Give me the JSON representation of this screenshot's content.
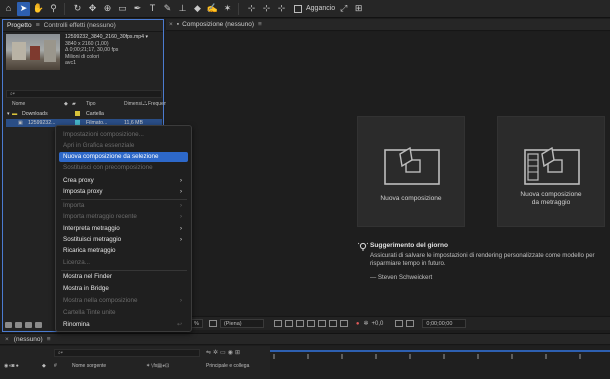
{
  "toolbar": {
    "tools": [
      "home-icon",
      "selection-arrow-icon",
      "hand-icon",
      "zoom-icon",
      "rotate-icon",
      "unified-camera-icon",
      "pan-behind-icon",
      "mask-rectangle-icon",
      "pen-icon",
      "type-icon",
      "brush-icon",
      "clone-stamp-icon",
      "eraser-icon",
      "roto-brush-icon",
      "puppet-pin-icon"
    ],
    "snap_label": "Aggancio"
  },
  "project_panel": {
    "tab_project": "Progetto",
    "tab_menu": "≡",
    "tab_effects": "Controlli effetti (nessuno)",
    "footage": {
      "name": "12599232_3840_2160_30fps.mp4 ▾",
      "resolution": "3840 x 2160 (1,00)",
      "duration": "Δ 0;00;21;17, 30,00 fps",
      "colors": "Milioni di colori",
      "codec": "avc1"
    },
    "search_placeholder": "⌕▾",
    "columns": {
      "name": "Nome",
      "type": "Tipo",
      "size": "Dimensi...",
      "freq": "Frequen"
    },
    "rows": [
      {
        "name": "Downloads",
        "type": "Cartella",
        "size": "",
        "tag_color": "#d8c23a"
      },
      {
        "name": "12599232...",
        "type": "Filmato...",
        "size": "11,6 MB",
        "tag_color": "#46b5c9"
      }
    ],
    "bottom_value": "8 bpc"
  },
  "composition_panel": {
    "tab_label": "Composizione (nessuno)",
    "tab_menu": "≡",
    "card_new_comp": "Nuova composizione",
    "card_new_comp_footage_line1": "Nuova composizione",
    "card_new_comp_footage_line2": "da metraggio",
    "tip_title": "Suggerimento del giorno",
    "tip_body": "Assicurati di salvare le impostazioni di rendering personalizzate come modello per risparmiare tempo in futuro.",
    "tip_author": "— Steven Schweickert",
    "footer": {
      "zoom": "%",
      "resolution": "(Piena)",
      "exposure": "+0,0",
      "timecode": "0;00;00;00"
    }
  },
  "timeline": {
    "tab_label": "(nessuno)",
    "tab_menu": "≡",
    "search_placeholder": "⌕▾",
    "col_source": "Nome sorgente",
    "col_parent": "Principale e collega"
  },
  "context_menu": {
    "items": [
      {
        "label": "Impostazioni composizione...",
        "enabled": false,
        "submenu": false
      },
      {
        "label": "Apri in Grafica essenziale",
        "enabled": false,
        "submenu": false
      },
      {
        "label": "Nuova composizione da selezione",
        "enabled": true,
        "submenu": false,
        "highlighted": true
      },
      {
        "label": "Sostituisci con precomposizione",
        "enabled": false,
        "submenu": false
      },
      {
        "label": "Crea proxy",
        "enabled": true,
        "submenu": true
      },
      {
        "label": "Imposta proxy",
        "enabled": true,
        "submenu": true
      },
      {
        "label": "Importa",
        "enabled": false,
        "submenu": true
      },
      {
        "label": "Importa metraggio recente",
        "enabled": false,
        "submenu": true
      },
      {
        "label": "Interpreta metraggio",
        "enabled": true,
        "submenu": true
      },
      {
        "label": "Sostituisci metraggio",
        "enabled": true,
        "submenu": true
      },
      {
        "label": "Ricarica metraggio",
        "enabled": true,
        "submenu": false
      },
      {
        "label": "Licenza...",
        "enabled": false,
        "submenu": false
      },
      {
        "label": "Mostra nel Finder",
        "enabled": true,
        "submenu": false
      },
      {
        "label": "Mostra in Bridge",
        "enabled": true,
        "submenu": false
      },
      {
        "label": "Mostra nella composizione",
        "enabled": false,
        "submenu": true
      },
      {
        "label": "Cartella Tinte unite",
        "enabled": false,
        "submenu": false
      },
      {
        "label": "Rinomina",
        "enabled": true,
        "submenu": false,
        "shortcut": "↩"
      }
    ]
  },
  "colors": {
    "accent": "#2d68c9",
    "panel_border_active": "#4b7bd0",
    "background": "#1d1d1d"
  }
}
